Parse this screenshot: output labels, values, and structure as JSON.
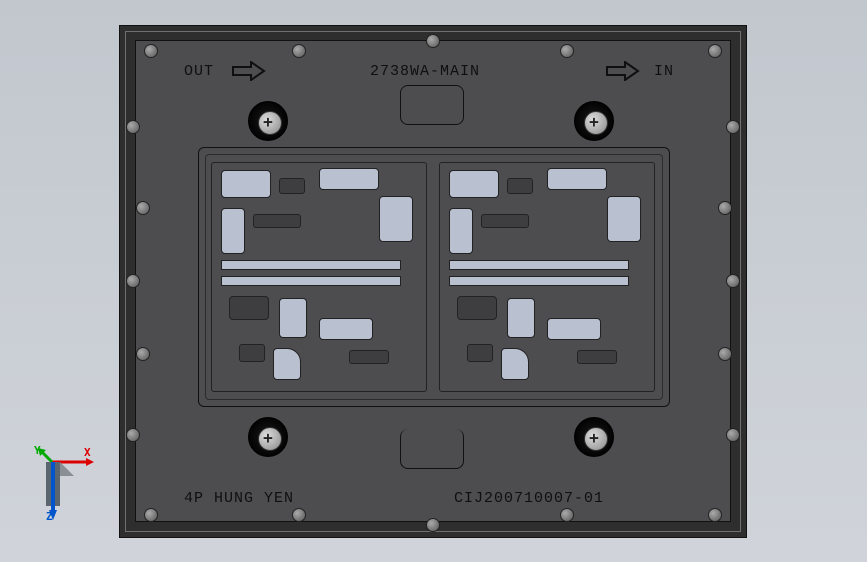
{
  "board": {
    "label_out": "OUT",
    "label_main": "2738WA-MAIN",
    "label_in": "IN",
    "label_4p": "4P HUNG YEN",
    "part_number": "CIJ200710007-01"
  },
  "gizmo": {
    "x": "X",
    "y": "Y",
    "z": "Z"
  },
  "icons": {
    "arrow_right": "arrow-right-icon",
    "phillips": "phillips-screw-icon"
  }
}
